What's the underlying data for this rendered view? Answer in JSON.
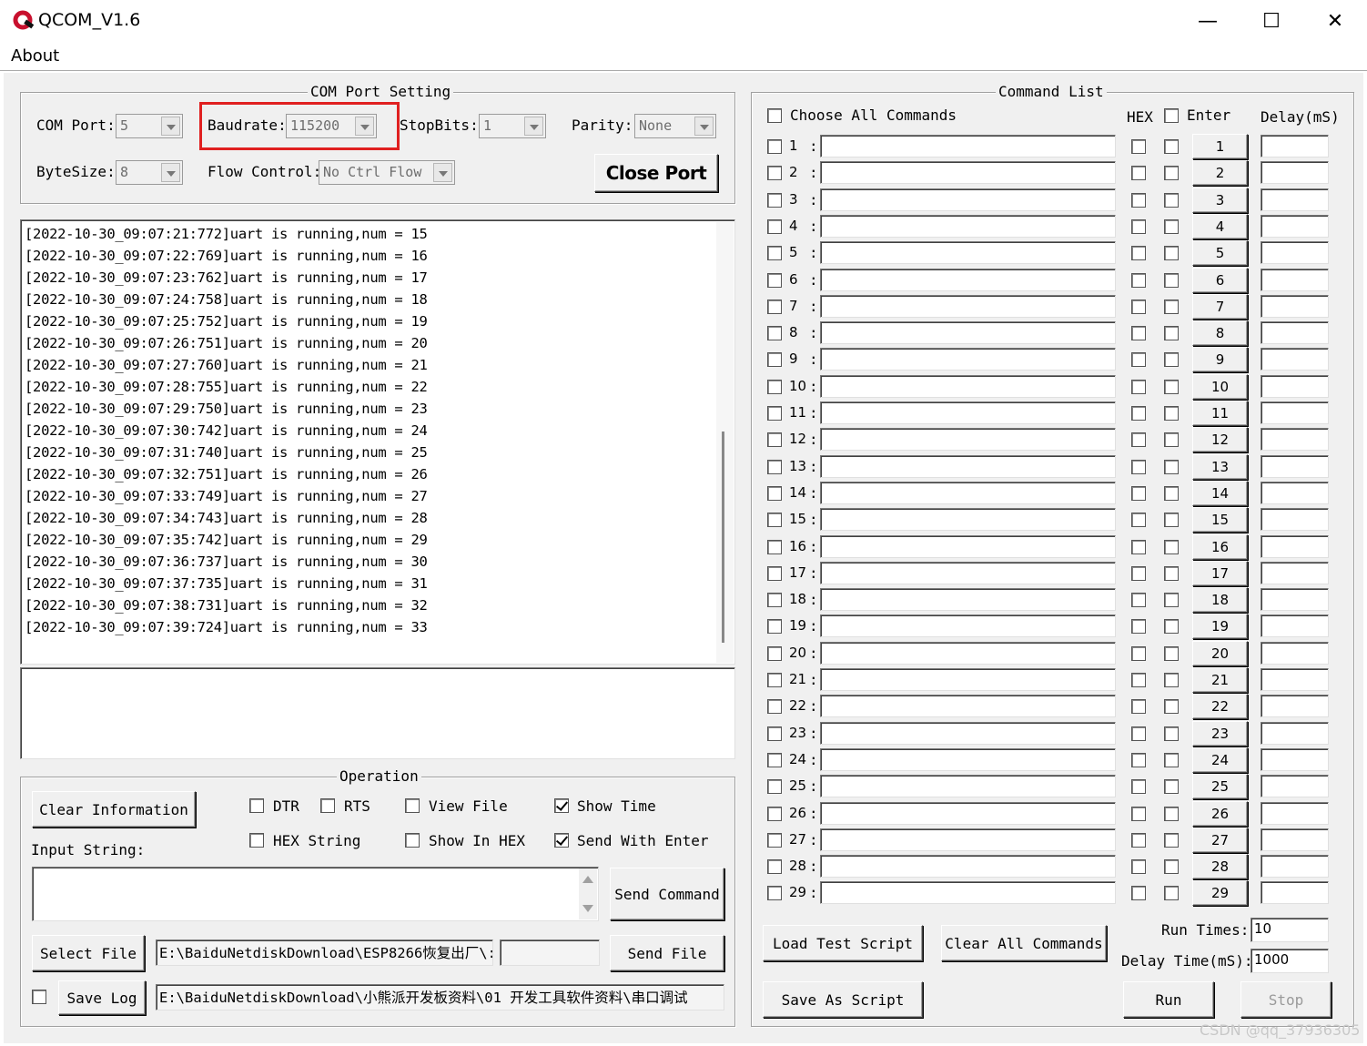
{
  "window": {
    "title": "QCOM_V1.6",
    "minimize": "—",
    "maximize": "☐",
    "close": "✕"
  },
  "menu": {
    "about": "About"
  },
  "com_port_setting": {
    "legend": "COM Port Setting",
    "com_port_label": "COM Port:",
    "com_port_value": "5",
    "baudrate_label": "Baudrate:",
    "baudrate_value": "115200",
    "stopbits_label": "StopBits:",
    "stopbits_value": "1",
    "parity_label": "Parity:",
    "parity_value": "None",
    "bytesize_label": "ByteSize:",
    "bytesize_value": "8",
    "flow_label": "Flow Control:",
    "flow_value": "No Ctrl Flow",
    "close_port": "Close Port"
  },
  "log_lines": [
    "[2022-10-30_09:07:21:772]uart is running,num = 15",
    "[2022-10-30_09:07:22:769]uart is running,num = 16",
    "[2022-10-30_09:07:23:762]uart is running,num = 17",
    "[2022-10-30_09:07:24:758]uart is running,num = 18",
    "[2022-10-30_09:07:25:752]uart is running,num = 19",
    "[2022-10-30_09:07:26:751]uart is running,num = 20",
    "[2022-10-30_09:07:27:760]uart is running,num = 21",
    "[2022-10-30_09:07:28:755]uart is running,num = 22",
    "[2022-10-30_09:07:29:750]uart is running,num = 23",
    "[2022-10-30_09:07:30:742]uart is running,num = 24",
    "[2022-10-30_09:07:31:740]uart is running,num = 25",
    "[2022-10-30_09:07:32:751]uart is running,num = 26",
    "[2022-10-30_09:07:33:749]uart is running,num = 27",
    "[2022-10-30_09:07:34:743]uart is running,num = 28",
    "[2022-10-30_09:07:35:742]uart is running,num = 29",
    "[2022-10-30_09:07:36:737]uart is running,num = 30",
    "[2022-10-30_09:07:37:735]uart is running,num = 31",
    "[2022-10-30_09:07:38:731]uart is running,num = 32",
    "[2022-10-30_09:07:39:724]uart is running,num = 33"
  ],
  "operation": {
    "legend": "Operation",
    "clear_information": "Clear Information",
    "dtr": "DTR",
    "rts": "RTS",
    "view_file": "View File",
    "show_time": "Show Time",
    "hex_string": "HEX String",
    "show_in_hex": "Show In HEX",
    "send_with_enter": "Send With Enter",
    "input_string_label": "Input String:",
    "send_command": "Send Command",
    "select_file": "Select File",
    "file_path": "E:\\BaiduNetdiskDownload\\ESP8266恢复出厂\\:",
    "send_file": "Send File",
    "save_log": "Save Log",
    "log_path": "E:\\BaiduNetdiskDownload\\小熊派开发板资料\\01 开发工具软件资料\\串口调试"
  },
  "command_list": {
    "legend": "Command List",
    "choose_all": "Choose All Commands",
    "hex_header": "HEX",
    "enter_header": "Enter",
    "delay_header": "Delay(mS)",
    "rows": [
      "1",
      "2",
      "3",
      "4",
      "5",
      "6",
      "7",
      "8",
      "9",
      "10",
      "11",
      "12",
      "13",
      "14",
      "15",
      "16",
      "17",
      "18",
      "19",
      "20",
      "21",
      "22",
      "23",
      "24",
      "25",
      "26",
      "27",
      "28",
      "29"
    ],
    "load_test_script": "Load Test Script",
    "clear_all_commands": "Clear All Commands",
    "save_as_script": "Save As Script",
    "run_times_label": "Run Times:",
    "run_times_value": "10",
    "delay_time_label": "Delay Time(mS):",
    "delay_time_value": "1000",
    "run": "Run",
    "stop": "Stop"
  },
  "watermark": "CSDN @qq_37936305",
  "colors": {
    "highlight_box": "#e02020"
  }
}
